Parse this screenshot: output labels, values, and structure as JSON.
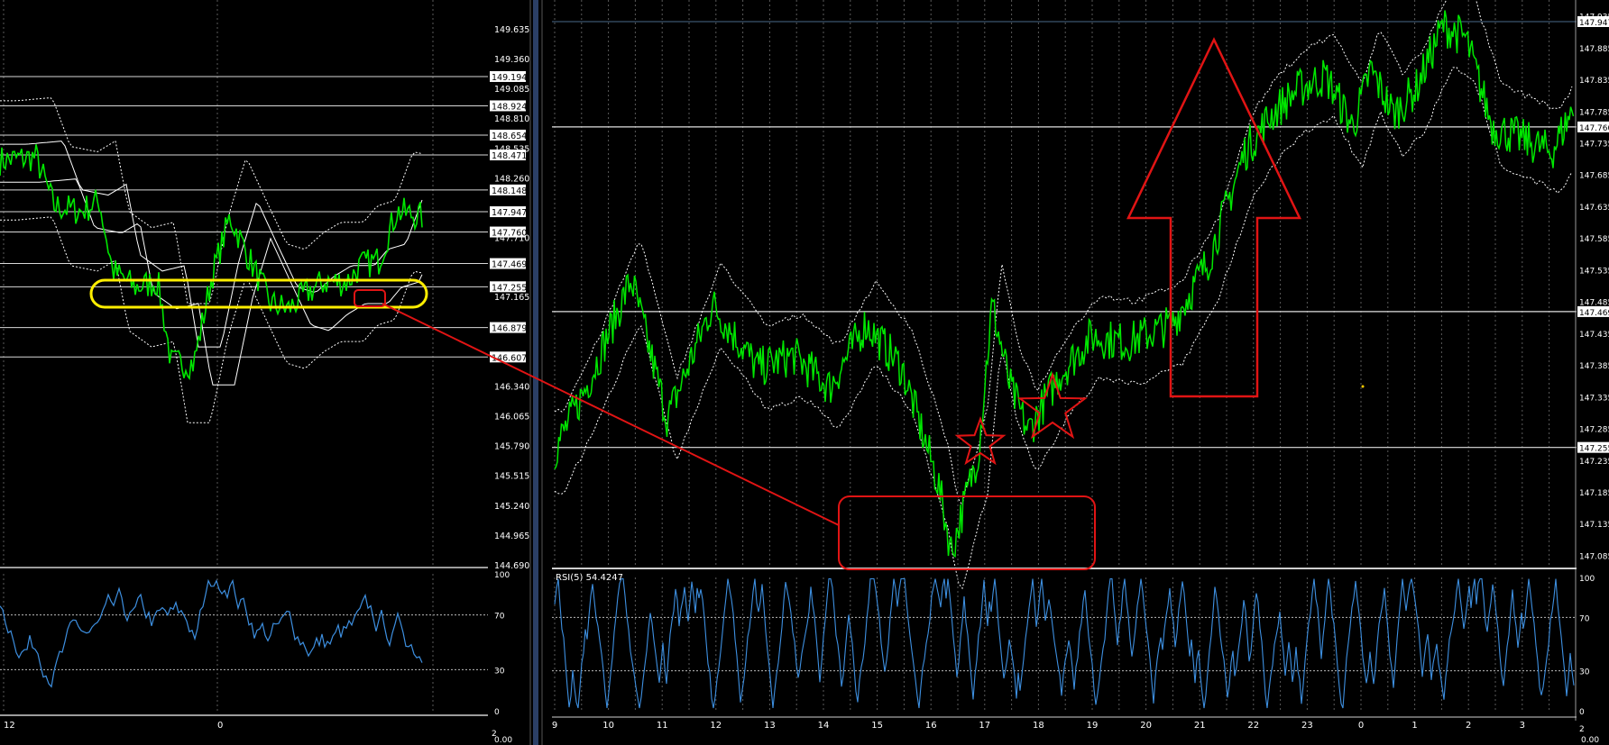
{
  "colors": {
    "background": "#000000",
    "price": "#00e600",
    "rsi": "#3d8fe0",
    "band": "#ffffff",
    "grid": "#5a5a5a",
    "annotation_red": "#e11414",
    "annotation_yellow": "#ffee00",
    "axis_text": "#ffffff",
    "separator": "#2b3f66"
  },
  "chart_data": [
    {
      "type": "line",
      "panel": "left-main",
      "y_ticks": [
        "149.635",
        "149.360",
        "149.085",
        "148.810",
        "148.535",
        "148.260",
        "147.710",
        "147.165",
        "146.340",
        "146.065",
        "145.790",
        "145.515",
        "145.240",
        "144.965",
        "144.690"
      ],
      "level_labels": [
        "149.194",
        "148.924",
        "148.654",
        "148.471",
        "148.148",
        "147.947",
        "147.760",
        "147.469",
        "147.255",
        "146.879",
        "146.607"
      ],
      "x_ticks": [
        "12",
        "0"
      ],
      "ylim": [
        144.69,
        149.9
      ],
      "grid": true
    },
    {
      "type": "line",
      "panel": "left-rsi",
      "y_ticks": [
        "100",
        "70",
        "30",
        "0"
      ],
      "bottom_labels": [
        "2",
        "0.00"
      ],
      "ylim": [
        0,
        100
      ]
    },
    {
      "type": "line",
      "panel": "right-main",
      "y_ticks": [
        "147.935",
        "147.885",
        "147.835",
        "147.785",
        "147.735",
        "147.685",
        "147.635",
        "147.585",
        "147.535",
        "147.485",
        "147.435",
        "147.385",
        "147.335",
        "147.285",
        "147.235",
        "147.185",
        "147.135",
        "147.085"
      ],
      "level_labels": [
        "147.947",
        "147.760",
        "147.469",
        "147.255"
      ],
      "x_ticks": [
        "9",
        "10",
        "11",
        "12",
        "13",
        "14",
        "15",
        "16",
        "17",
        "18",
        "19",
        "20",
        "21",
        "22",
        "23",
        "0",
        "1",
        "2",
        "3"
      ],
      "ylim": [
        147.07,
        147.96
      ],
      "grid": true
    },
    {
      "type": "line",
      "panel": "right-rsi",
      "legend": "RSI(5) 54.4247",
      "y_ticks": [
        "100",
        "70",
        "30",
        "0"
      ],
      "bottom_labels": [
        "2",
        "0.00"
      ],
      "ylim": [
        0,
        100
      ]
    }
  ]
}
